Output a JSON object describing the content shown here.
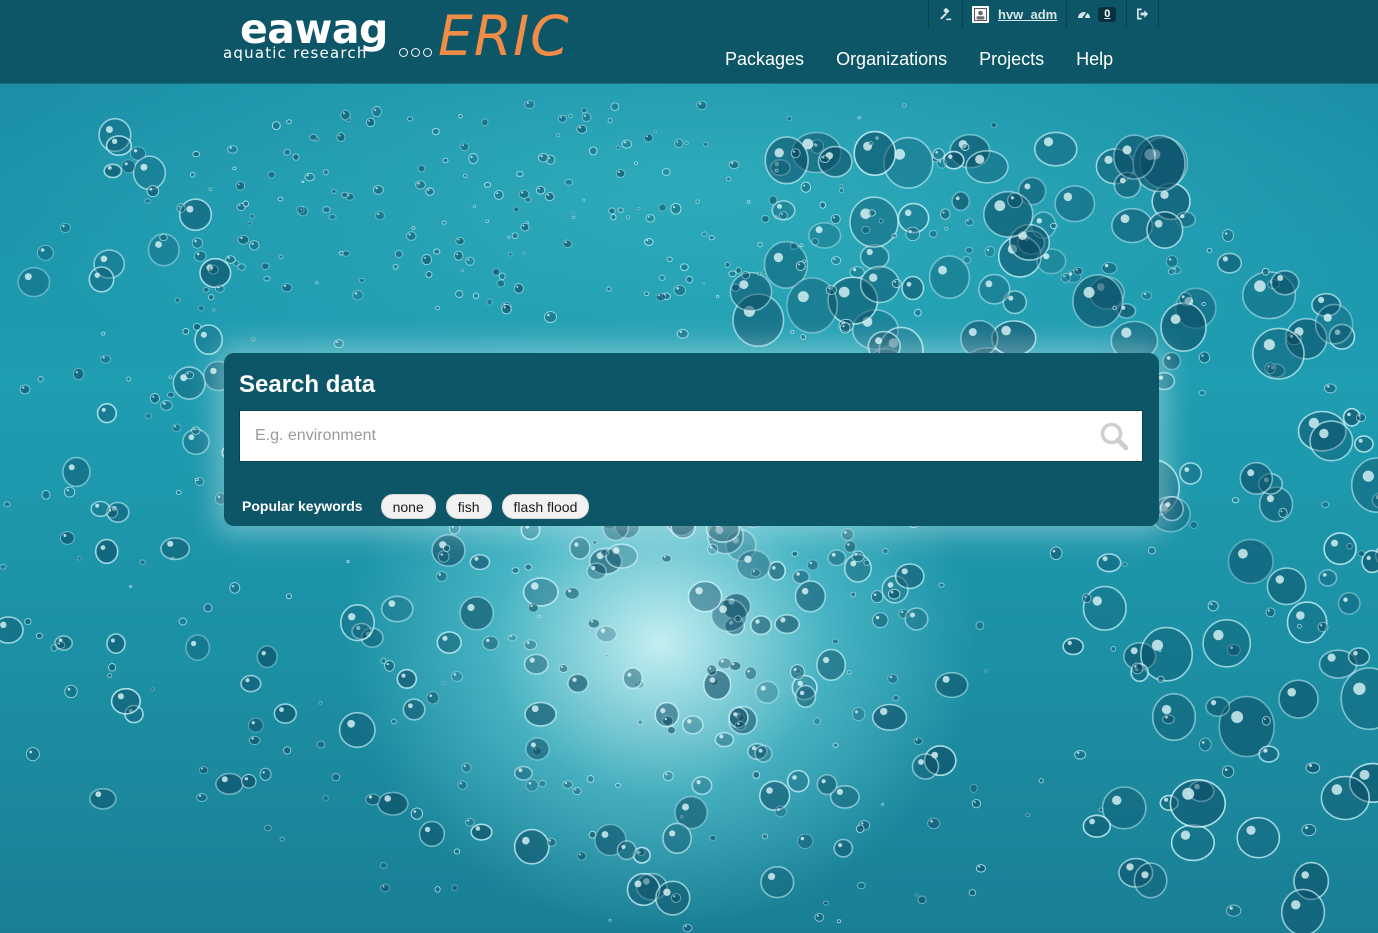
{
  "brand": {
    "name": "eawag",
    "tagline": "aquatic research",
    "product": "ERIC",
    "colors": {
      "header": "#0c5668",
      "accent": "#f08c45"
    }
  },
  "account": {
    "sysadmin_icon": "gavel-icon",
    "avatar_icon": "avatar-icon",
    "username": "hvw_adm",
    "dashboard_icon": "dashboard-icon",
    "notifications": "0",
    "logout_icon": "sign-out-icon"
  },
  "nav": {
    "items": [
      {
        "label": "Packages"
      },
      {
        "label": "Organizations"
      },
      {
        "label": "Projects"
      },
      {
        "label": "Help"
      }
    ]
  },
  "search": {
    "title": "Search data",
    "placeholder": "E.g. environment",
    "value": "",
    "button_icon": "search-icon"
  },
  "keywords": {
    "label": "Popular keywords",
    "tags": [
      "none",
      "fish",
      "flash flood"
    ]
  }
}
